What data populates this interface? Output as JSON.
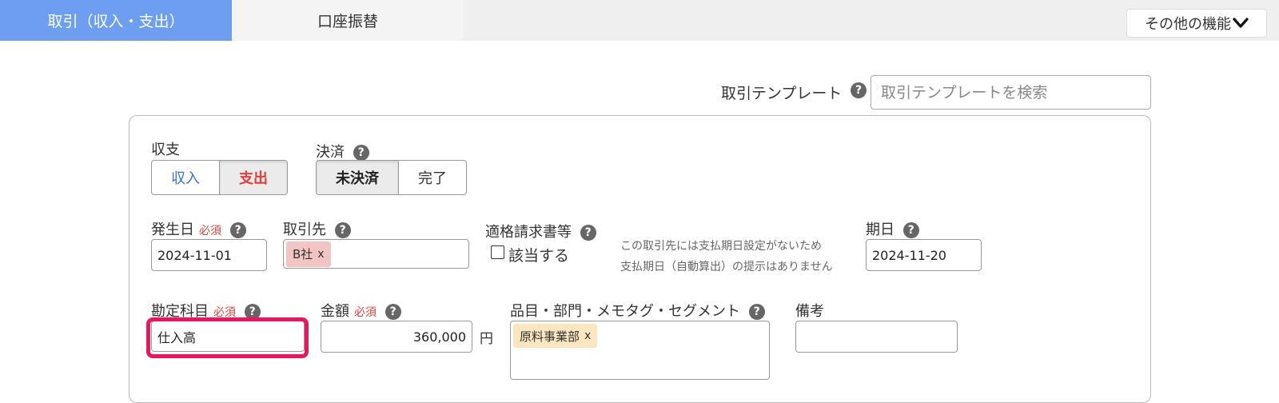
{
  "tabs": {
    "active_label": "取引（収入・支出）",
    "inactive_label": "口座振替"
  },
  "more_button": {
    "label": "その他の機能",
    "icon": "chevron-down-icon"
  },
  "template": {
    "label": "取引テンプレート",
    "placeholder": "取引テンプレートを検索"
  },
  "help_glyph": "?",
  "form": {
    "income_expense": {
      "label": "収支",
      "options": [
        "収入",
        "支出"
      ],
      "selected": "支出",
      "colors": {
        "income": "#3a6fd8",
        "expense": "#e0403a"
      }
    },
    "settlement": {
      "label": "決済",
      "options": [
        "未決済",
        "完了"
      ],
      "selected": "未決済"
    },
    "issue_date": {
      "label": "発生日",
      "required": "必須",
      "value": "2024-11-01"
    },
    "partner": {
      "label": "取引先",
      "chip": "B社",
      "chip_remove": "x",
      "chip_color": "#f2c4c4"
    },
    "invoice": {
      "label": "適格請求書等",
      "checkbox_label": "該当する",
      "checked": false
    },
    "due_note": {
      "line1": "この取引先には支払期日設定がないため",
      "line2": "支払期日（自動算出）の提示はありません"
    },
    "due_date": {
      "label": "期日",
      "value": "2024-11-20"
    },
    "account": {
      "label": "勘定科目",
      "required": "必須",
      "value": "仕入高"
    },
    "amount": {
      "label": "金額",
      "required": "必須",
      "value": "360,000",
      "unit": "円"
    },
    "tags": {
      "label": "品目・部門・メモタグ・セグメント",
      "chip": "原料事業部",
      "chip_remove": "x",
      "chip_color": "#fbe6bf"
    },
    "remarks": {
      "label": "備考",
      "value": ""
    }
  },
  "colors": {
    "tab_active_bg": "#6d9ef0",
    "highlight_border": "#e8175d"
  }
}
